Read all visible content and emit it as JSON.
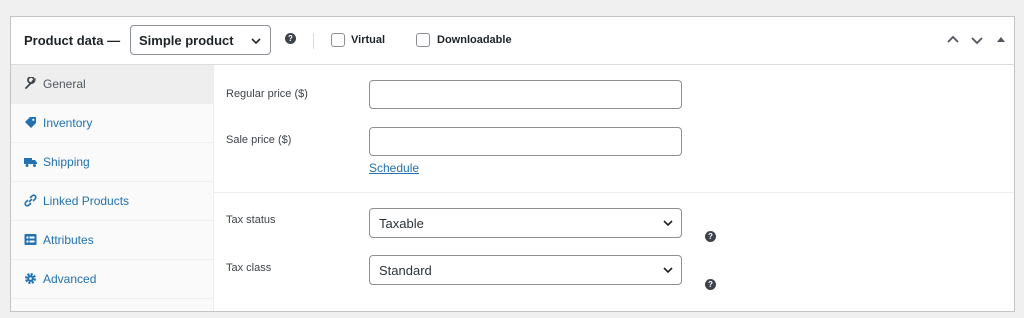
{
  "header": {
    "title": "Product data —",
    "product_type": "Simple product",
    "virtual_label": "Virtual",
    "downloadable_label": "Downloadable"
  },
  "tabs": [
    {
      "label": "General",
      "icon": "wrench-icon",
      "active": true
    },
    {
      "label": "Inventory",
      "icon": "tag-icon"
    },
    {
      "label": "Shipping",
      "icon": "truck-icon"
    },
    {
      "label": "Linked Products",
      "icon": "link-icon"
    },
    {
      "label": "Attributes",
      "icon": "list-icon"
    },
    {
      "label": "Advanced",
      "icon": "gear-icon"
    }
  ],
  "general": {
    "regular_price_label": "Regular price ($)",
    "regular_price_value": "",
    "sale_price_label": "Sale price ($)",
    "sale_price_value": "",
    "schedule_link": "Schedule",
    "tax_status_label": "Tax status",
    "tax_status_value": "Taxable",
    "tax_class_label": "Tax class",
    "tax_class_value": "Standard"
  },
  "colors": {
    "accent": "#2271b1",
    "text": "#1d2327",
    "border": "#8c8f94"
  }
}
